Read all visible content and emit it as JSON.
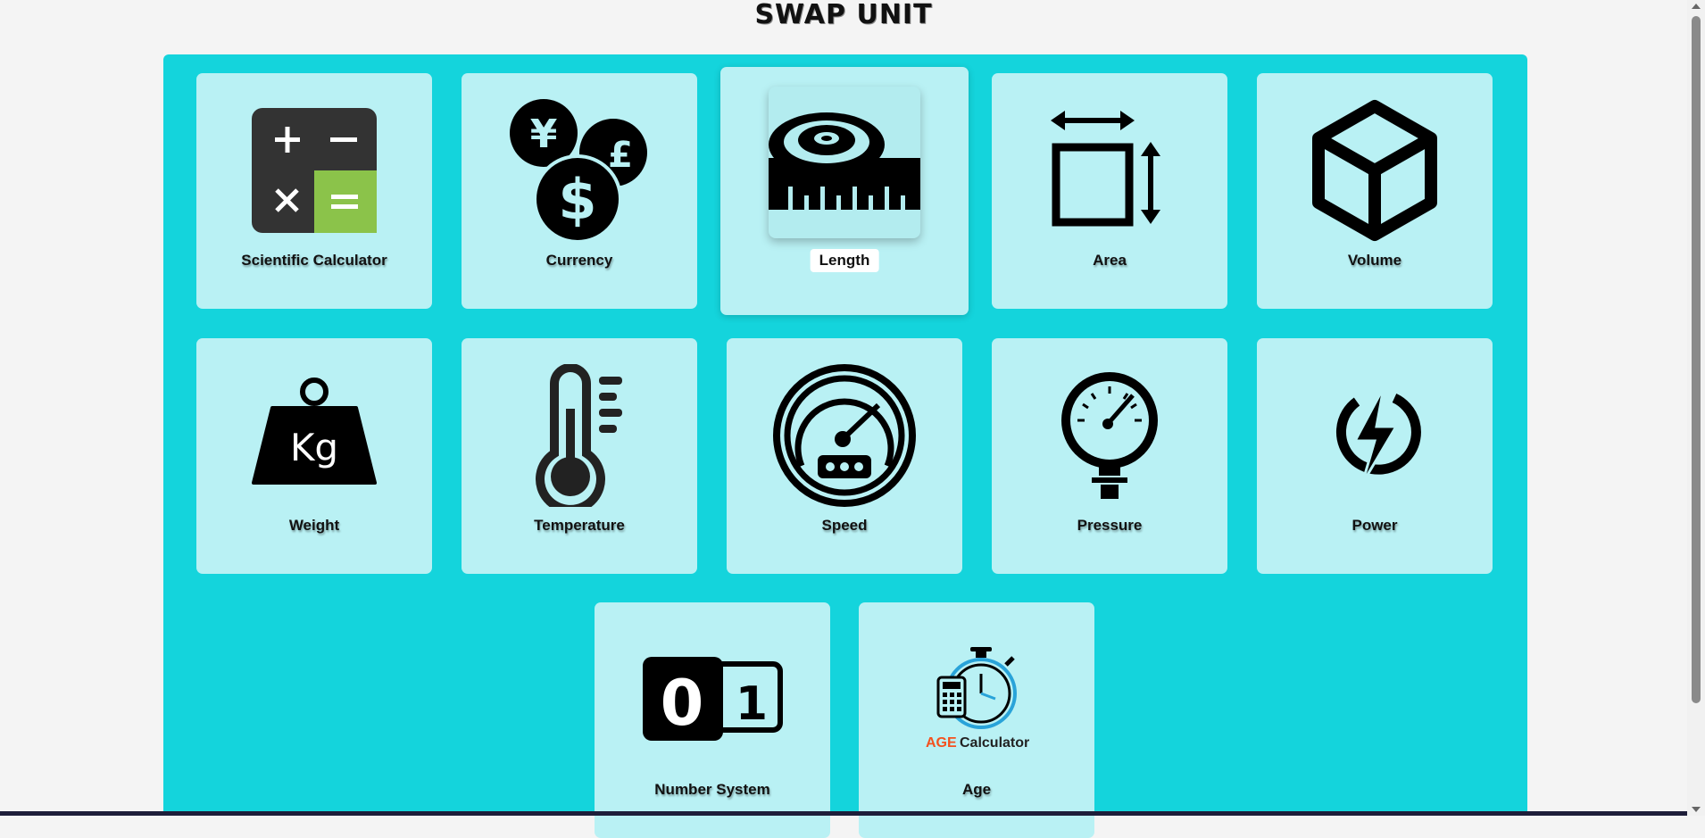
{
  "app": {
    "title": "SWAP UNIT"
  },
  "colors": {
    "panel": "#14d4dc",
    "card": "#b9f1f4",
    "calc_green": "#8bc34a",
    "age_orange": "#f4511e"
  },
  "cards": [
    {
      "label": "Scientific Calculator",
      "icon": "calculator-icon"
    },
    {
      "label": "Currency",
      "icon": "currency-icon"
    },
    {
      "label": "Length",
      "icon": "tape-measure-icon",
      "active": true
    },
    {
      "label": "Area",
      "icon": "area-icon"
    },
    {
      "label": "Volume",
      "icon": "cube-icon"
    },
    {
      "label": "Weight",
      "icon": "weight-icon",
      "icon_text": "Kg"
    },
    {
      "label": "Temperature",
      "icon": "thermometer-icon"
    },
    {
      "label": "Speed",
      "icon": "speedometer-icon"
    },
    {
      "label": "Pressure",
      "icon": "pressure-gauge-icon"
    },
    {
      "label": "Power",
      "icon": "power-icon"
    },
    {
      "label": "Number System",
      "icon": "binary-icon",
      "icon_text": [
        "0",
        "1"
      ]
    },
    {
      "label": "Age",
      "icon": "age-calculator-icon",
      "icon_text": [
        "AGE",
        "Calculator"
      ]
    }
  ]
}
